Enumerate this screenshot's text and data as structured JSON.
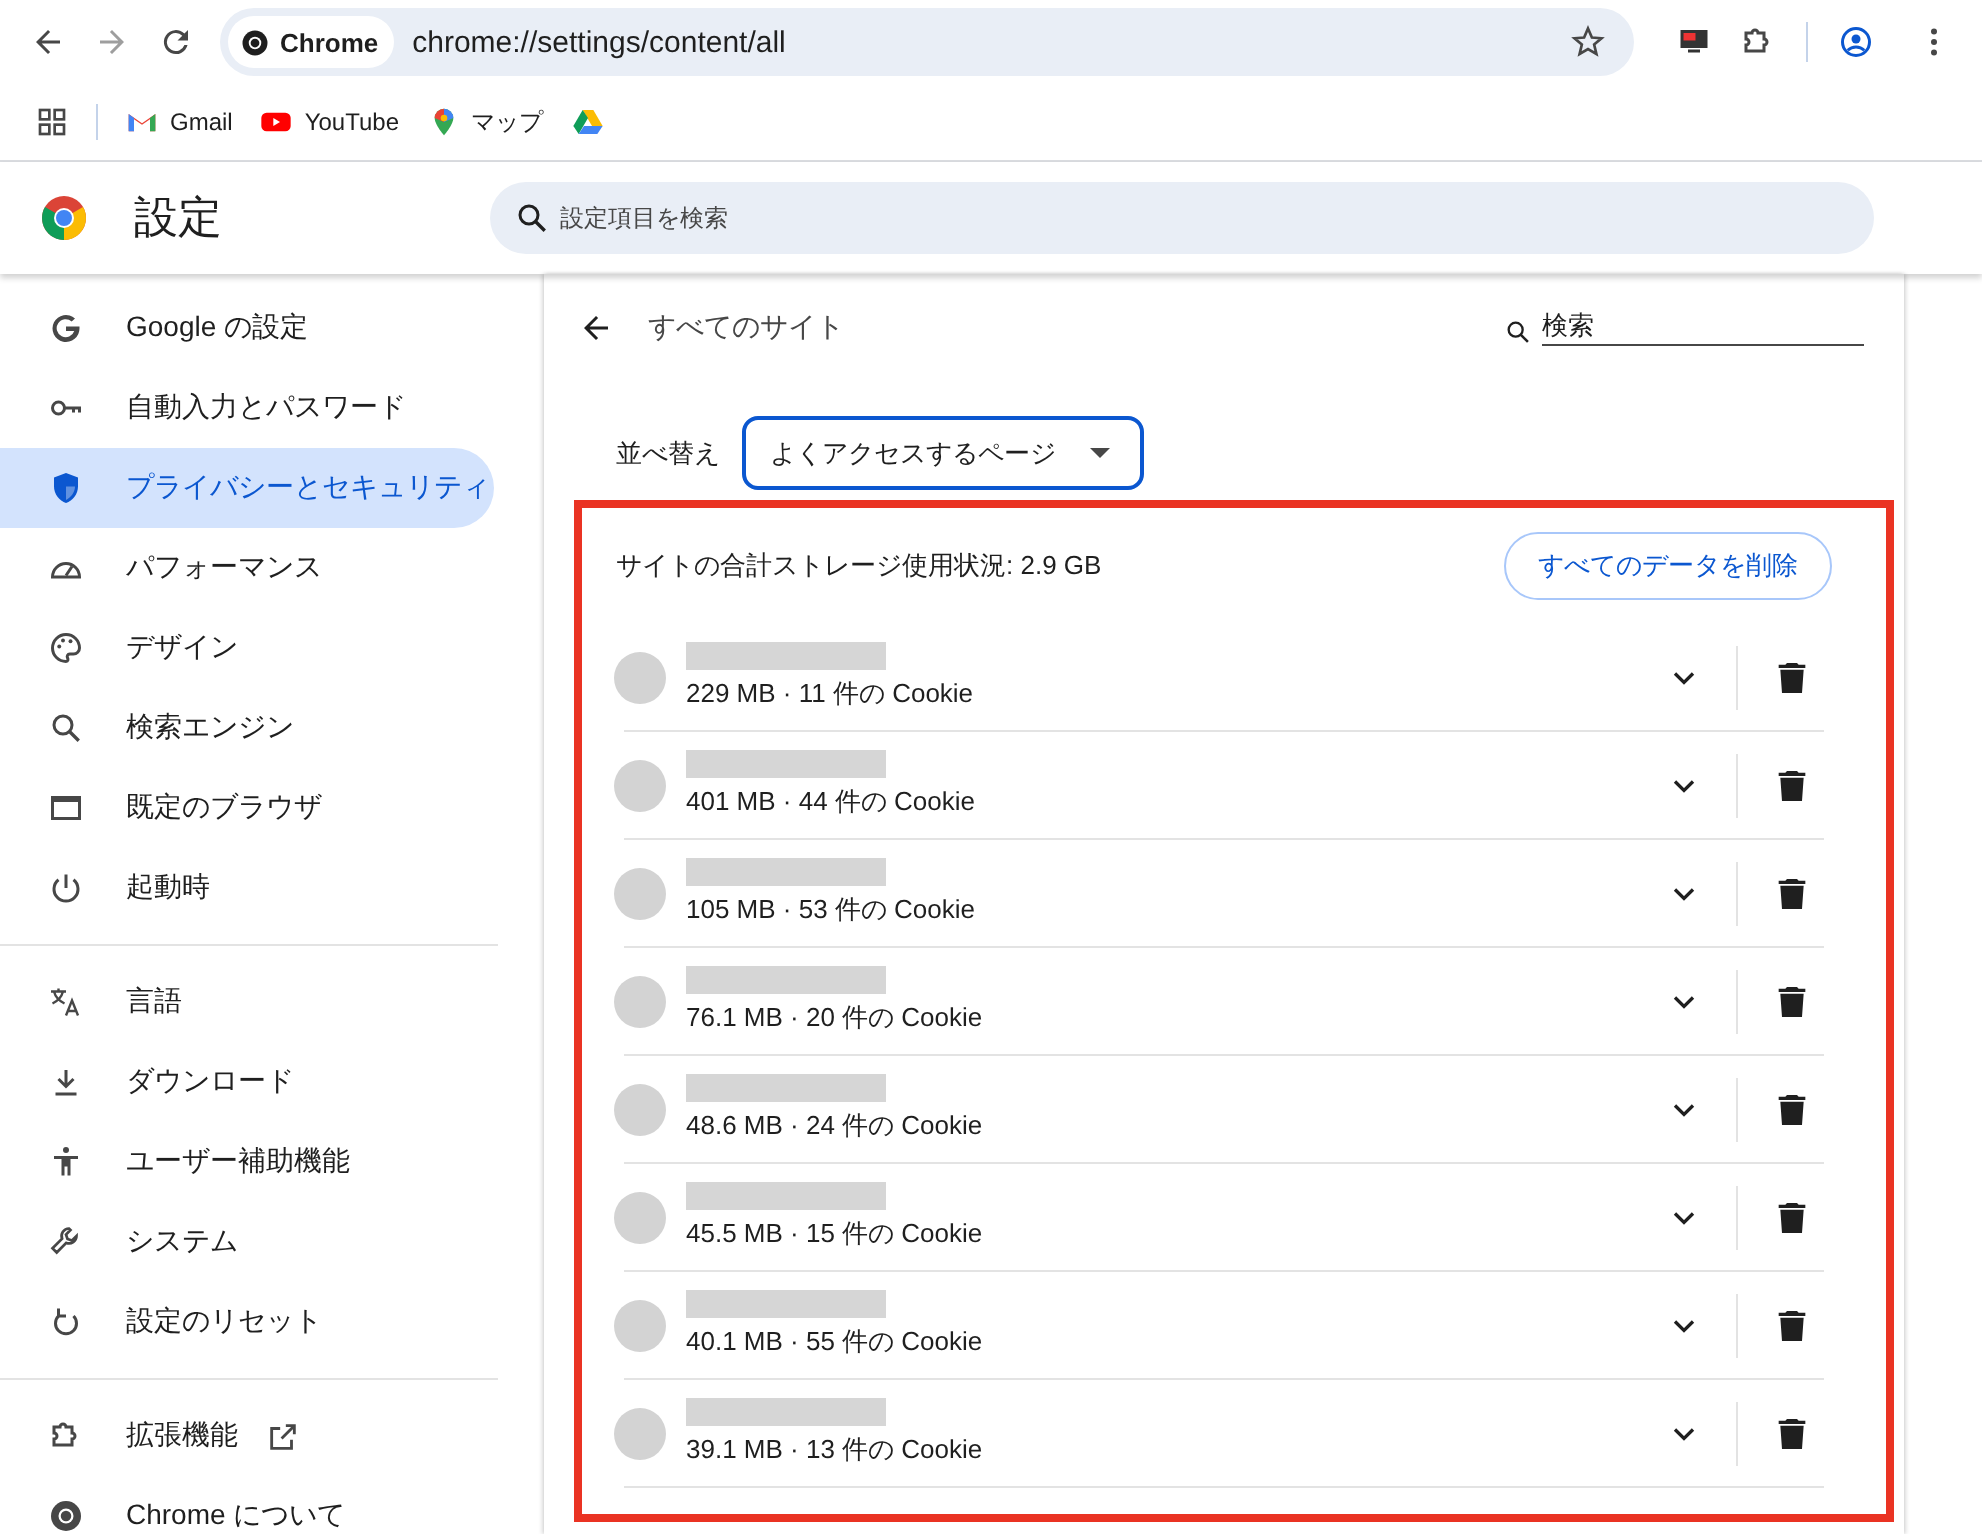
{
  "browser": {
    "chip": "Chrome",
    "url": "chrome://settings/content/all",
    "bookmarks": [
      {
        "kind": "gmail",
        "label": "Gmail"
      },
      {
        "kind": "youtube",
        "label": "YouTube"
      },
      {
        "kind": "maps",
        "label": "マップ"
      },
      {
        "kind": "drive"
      }
    ]
  },
  "settings": {
    "title": "設定",
    "search_placeholder": "設定項目を検索"
  },
  "sidebar": {
    "groups": [
      [
        {
          "label": "Google の設定",
          "selected": false,
          "external": false
        },
        {
          "label": "自動入力とパスワード",
          "selected": false,
          "external": false
        },
        {
          "label": "プライバシーとセキュリティ",
          "selected": true,
          "external": false
        },
        {
          "label": "パフォーマンス",
          "selected": false,
          "external": false
        },
        {
          "label": "デザイン",
          "selected": false,
          "external": false
        },
        {
          "label": "検索エンジン",
          "selected": false,
          "external": false
        },
        {
          "label": "既定のブラウザ",
          "selected": false,
          "external": false
        },
        {
          "label": "起動時",
          "selected": false,
          "external": false
        }
      ],
      [
        {
          "label": "言語",
          "selected": false,
          "external": false
        },
        {
          "label": "ダウンロード",
          "selected": false,
          "external": false
        },
        {
          "label": "ユーザー補助機能",
          "selected": false,
          "external": false
        },
        {
          "label": "システム",
          "selected": false,
          "external": false
        },
        {
          "label": "設定のリセット",
          "selected": false,
          "external": false
        }
      ],
      [
        {
          "label": "拡張機能",
          "selected": false,
          "external": true
        },
        {
          "label": "Chrome について",
          "selected": false,
          "external": false
        }
      ]
    ]
  },
  "page": {
    "title": "すべてのサイト",
    "search_placeholder": "検索",
    "sort_label": "並べ替え",
    "sort_value": "よくアクセスするページ",
    "storage_summary": "サイトの合計ストレージ使用状況: 2.9 GB",
    "delete_all": "すべてのデータを削除",
    "sites": [
      {
        "detail": "229 MB · 11 件の Cookie"
      },
      {
        "detail": "401 MB · 44 件の Cookie"
      },
      {
        "detail": "105 MB · 53 件の Cookie"
      },
      {
        "detail": "76.1 MB · 20 件の Cookie"
      },
      {
        "detail": "48.6 MB · 24 件の Cookie"
      },
      {
        "detail": "45.5 MB · 15 件の Cookie"
      },
      {
        "detail": "40.1 MB · 55 件の Cookie"
      },
      {
        "detail": "39.1 MB · 13 件の Cookie"
      }
    ]
  }
}
